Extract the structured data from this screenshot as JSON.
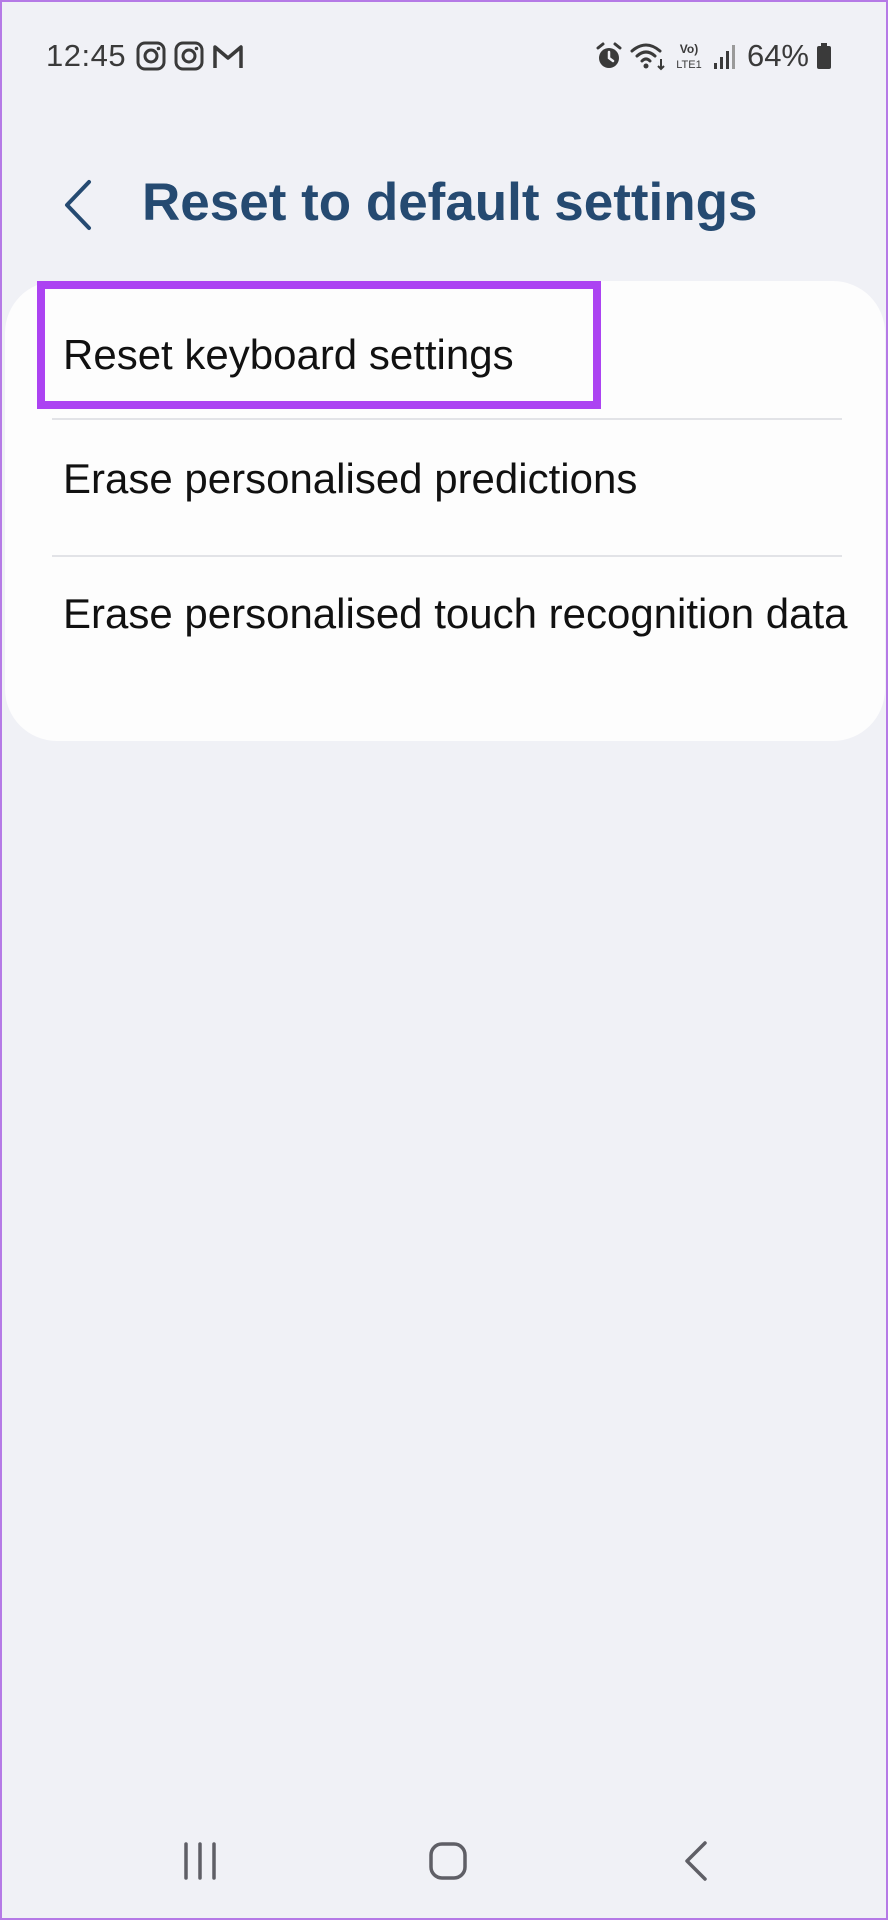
{
  "status_bar": {
    "time": "12:45",
    "left_icons": [
      "instagram-icon",
      "instagram-icon",
      "gmail-icon"
    ],
    "right_icons": [
      "alarm-icon",
      "wifi-icon",
      "volte-lte-icon",
      "signal-icon"
    ],
    "battery_percent": "64%"
  },
  "header": {
    "back_icon": "chevron-left-icon",
    "title": "Reset to default settings"
  },
  "settings": {
    "items": [
      {
        "label": "Reset keyboard settings"
      },
      {
        "label": "Erase personalised predictions"
      },
      {
        "label": "Erase personalised touch recognition data"
      }
    ]
  },
  "annotation": {
    "highlight_color": "#ac43f2",
    "highlighted_item": "Reset keyboard settings"
  },
  "nav_bar": {
    "buttons": [
      "recents-icon",
      "home-icon",
      "back-icon"
    ]
  },
  "colors": {
    "background": "#f0f1f6",
    "title": "#254a71",
    "card": "#fdfdfd"
  }
}
